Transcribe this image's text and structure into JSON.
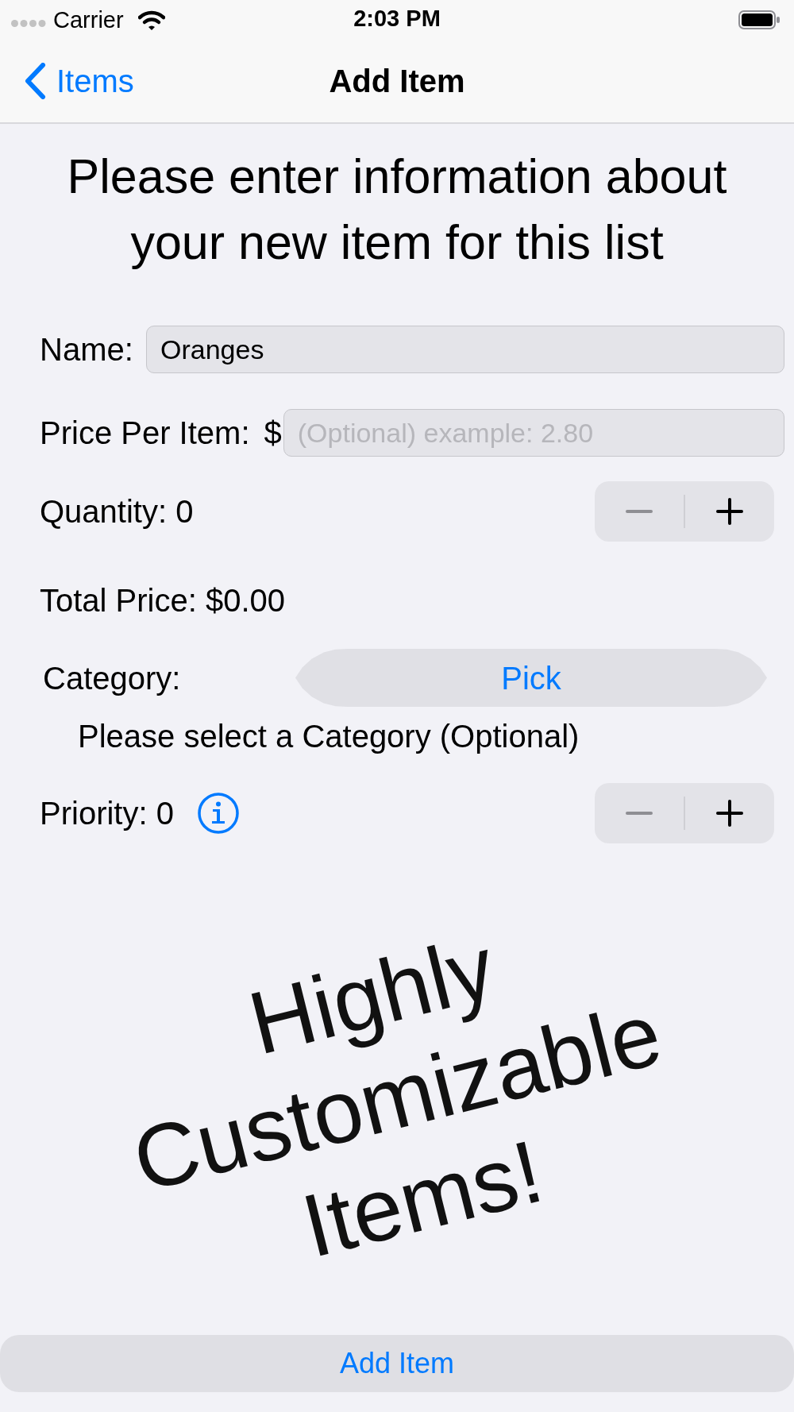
{
  "status_bar": {
    "carrier": "Carrier",
    "time": "2:03 PM"
  },
  "nav_bar": {
    "back_label": "Items",
    "title": "Add Item"
  },
  "heading": "Please enter information about your new item for this list",
  "form": {
    "name": {
      "label": "Name:",
      "value": "Oranges"
    },
    "price": {
      "label": "Price Per Item:",
      "currency": "$",
      "placeholder": "(Optional) example: 2.80"
    },
    "quantity": {
      "label": "Quantity: 0",
      "decrement_disabled": true
    },
    "total": "Total Price: $0.00",
    "category": {
      "label": "Category:",
      "button": "Pick",
      "hint": "Please select a Category (Optional)"
    },
    "priority": {
      "label": "Priority: 0",
      "decrement_disabled": true
    }
  },
  "promo_lines": [
    "Highly",
    "Customizable",
    "Items!"
  ],
  "add_button": "Add Item"
}
